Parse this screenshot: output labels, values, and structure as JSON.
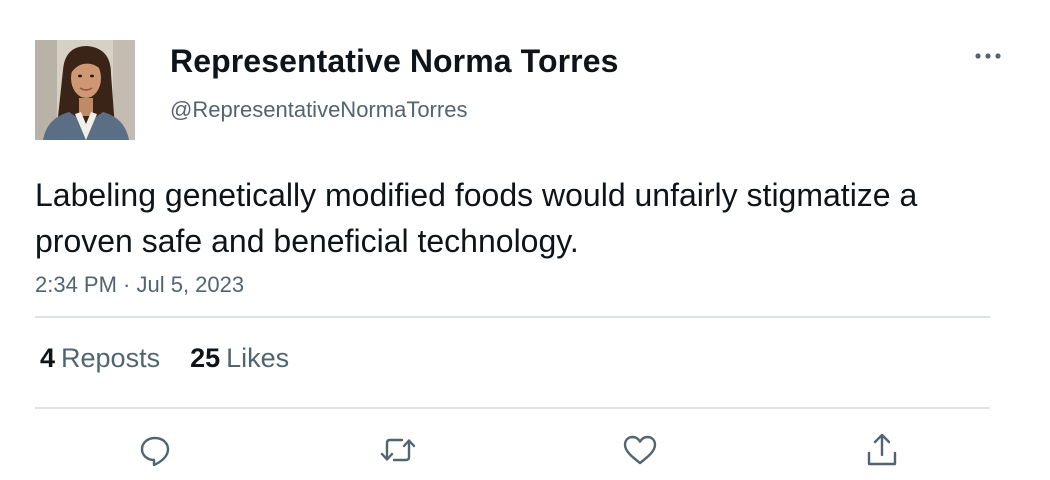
{
  "author": {
    "display_name": "Representative Norma Torres",
    "handle": "@RepresentativeNormaTorres",
    "avatar_icon": "profile-photo"
  },
  "tweet": {
    "text": "Labeling genetically modified foods would unfairly stigmatize a proven safe and beneficial technology.",
    "timestamp": "2:34 PM · Jul 5, 2023"
  },
  "stats": {
    "reposts_count": "4",
    "reposts_label": "Reposts",
    "likes_count": "25",
    "likes_label": "Likes"
  },
  "actions": [
    {
      "icon": "reply-icon"
    },
    {
      "icon": "repost-icon"
    },
    {
      "icon": "like-icon"
    },
    {
      "icon": "share-icon"
    }
  ],
  "colors": {
    "primary_text": "#0f1419",
    "secondary_text": "#536471",
    "divider": "#dfe3e6",
    "background": "#ffffff"
  }
}
